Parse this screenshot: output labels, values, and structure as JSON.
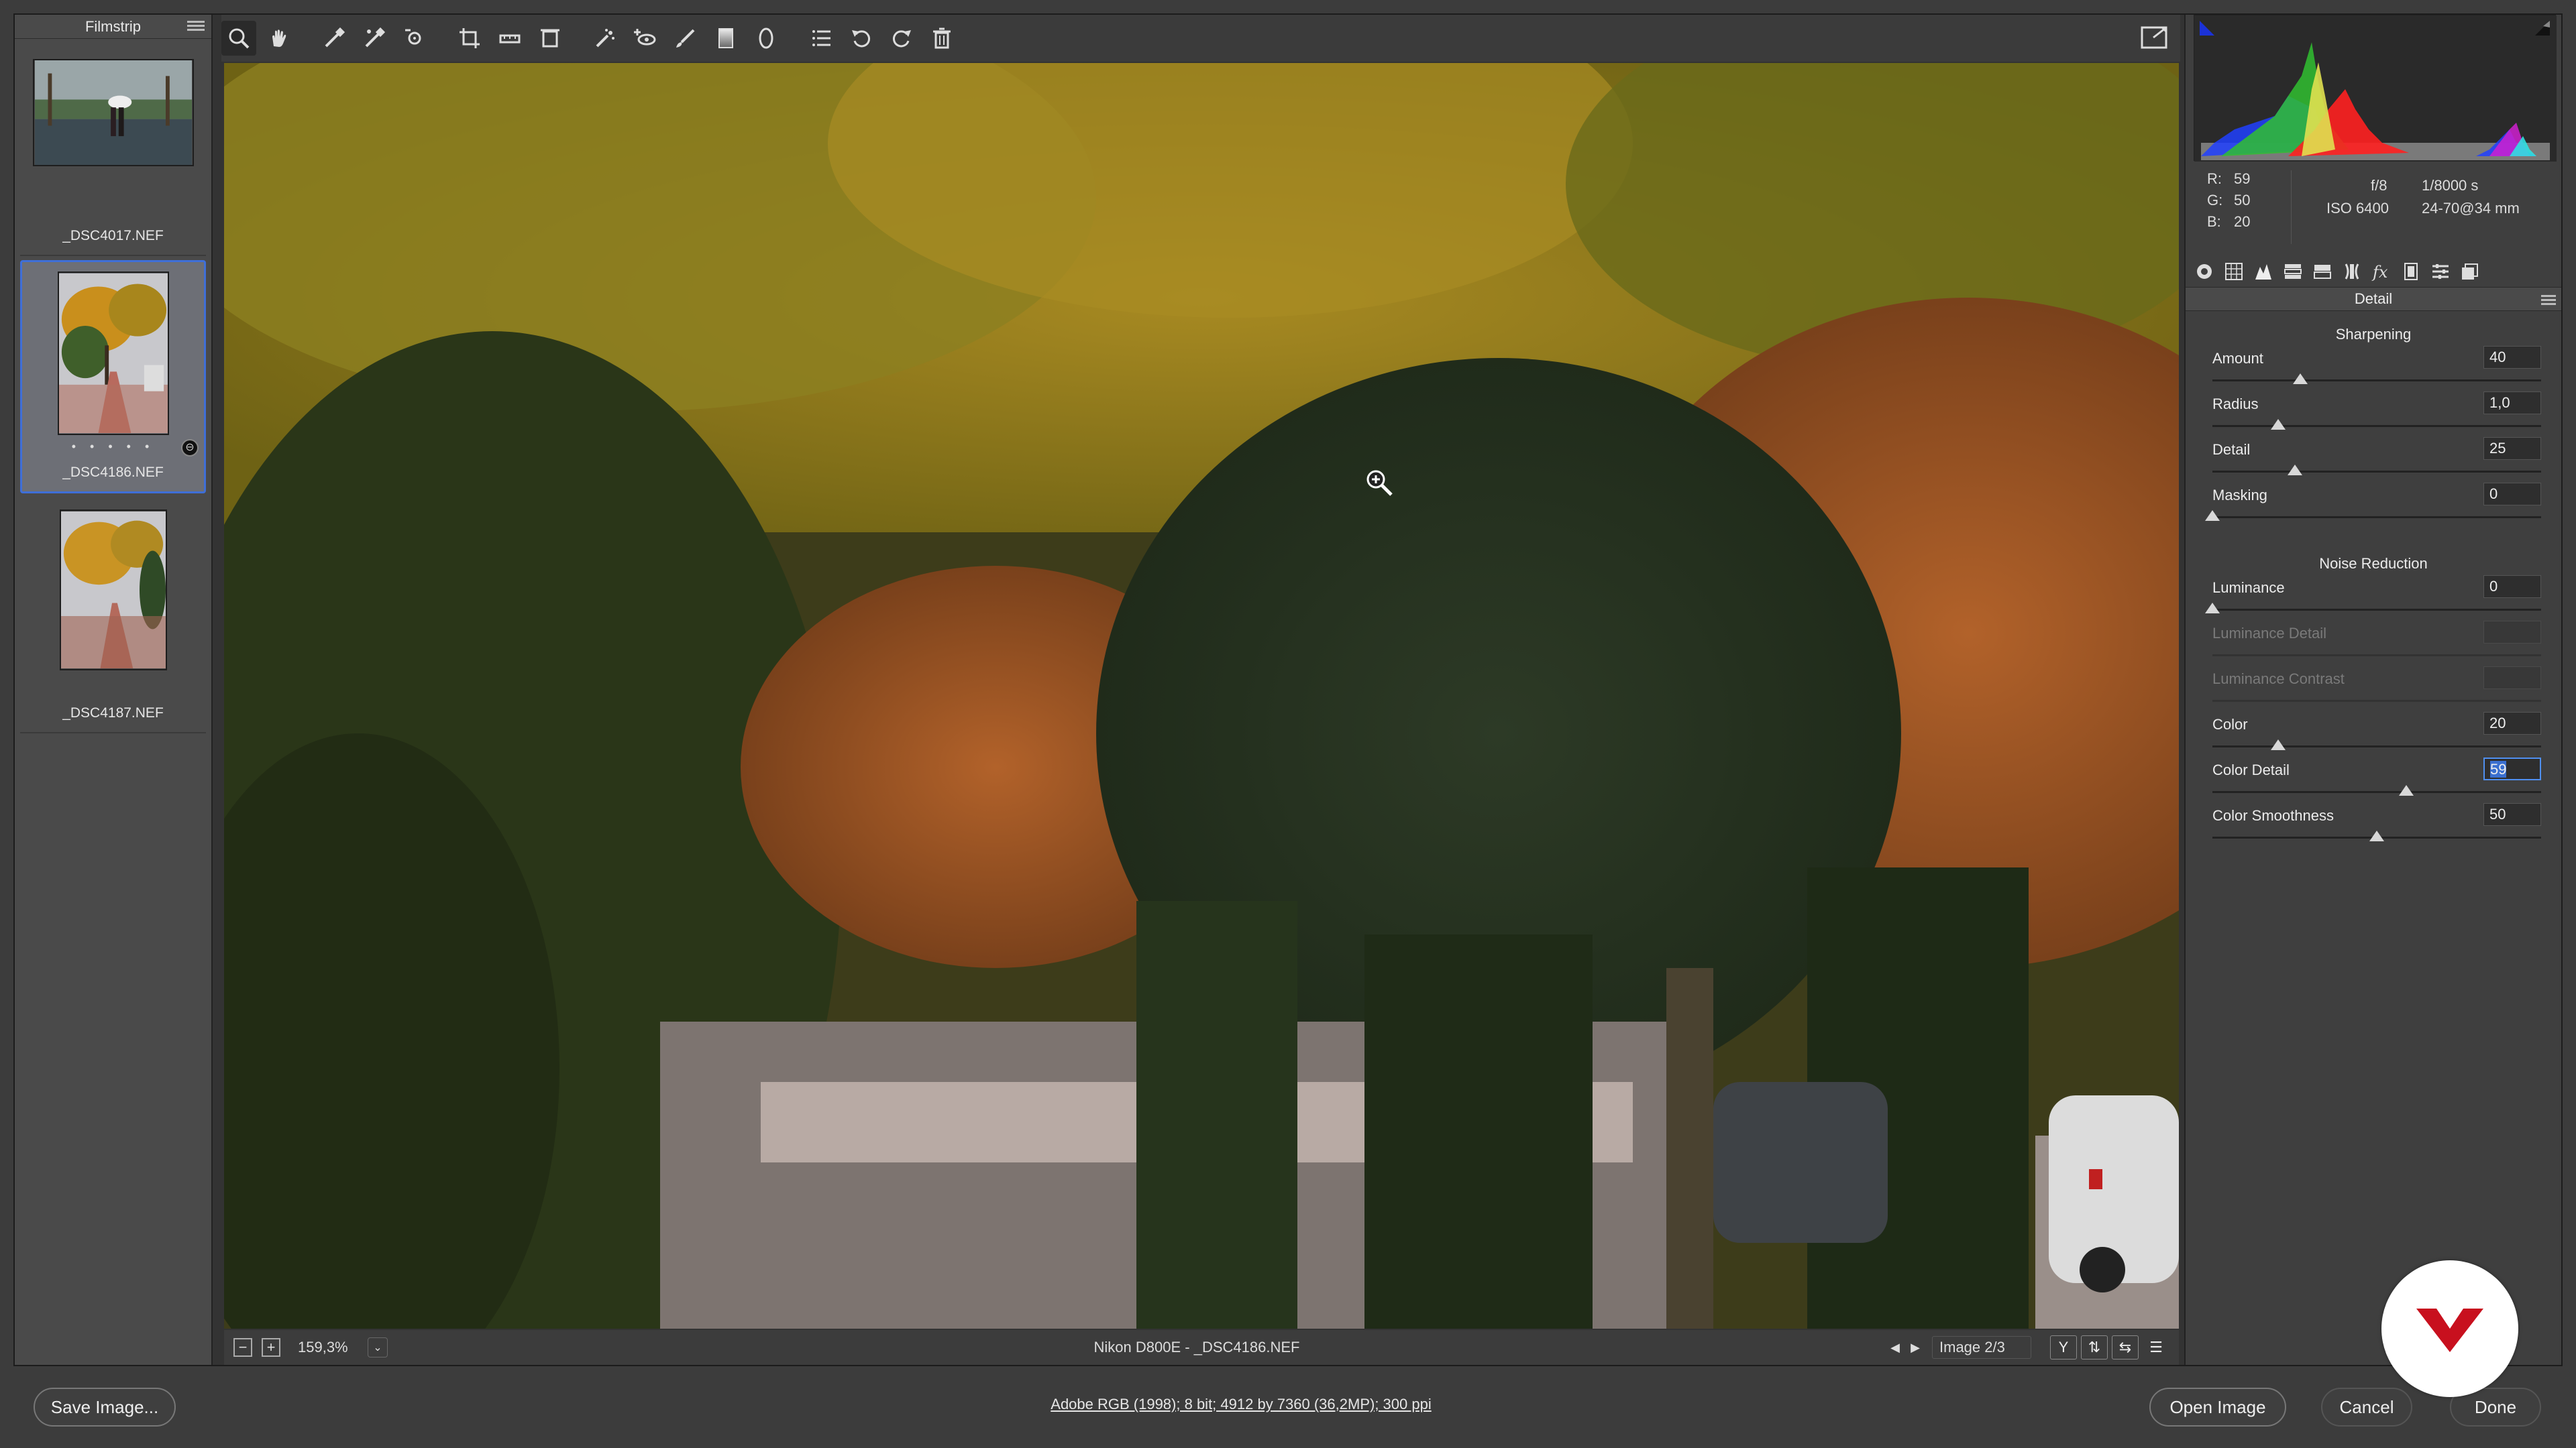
{
  "filmstrip": {
    "title": "Filmstrip",
    "items": [
      {
        "label": "_DSC4017.NEF",
        "selected": false,
        "rating": ""
      },
      {
        "label": "_DSC4186.NEF",
        "selected": true,
        "rating": "• • • • •"
      },
      {
        "label": "_DSC4187.NEF",
        "selected": false,
        "rating": ""
      }
    ]
  },
  "toolbar": {
    "tools": [
      "zoom-tool",
      "hand-tool",
      "white-balance-tool",
      "color-sampler-tool",
      "targeted-adjustment-tool",
      "crop-tool",
      "straighten-tool",
      "transform-tool",
      "spot-removal-tool",
      "red-eye-tool",
      "adjustment-brush-tool",
      "graduated-filter-tool",
      "radial-filter-tool",
      "presets-list",
      "rotate-left",
      "rotate-right",
      "delete"
    ],
    "active_tool": "zoom-tool"
  },
  "statusbar": {
    "zoom_minus": "−",
    "zoom_plus": "+",
    "zoom_level": "159,3%",
    "zoom_dropdown": "⌄",
    "camera_file": "Nikon D800E  -  _DSC4186.NEF",
    "prev": "◀",
    "next": "▶",
    "image_counter": "Image 2/3",
    "view_before_after": "Y",
    "view_swap": "⇅",
    "view_copy": "⇆",
    "view_settings": "☰"
  },
  "readout": {
    "r_label": "R:",
    "r_value": "59",
    "g_label": "G:",
    "g_value": "50",
    "b_label": "B:",
    "b_value": "20",
    "aperture": "f/8",
    "shutter": "1/8000 s",
    "iso": "ISO 6400",
    "lens": "24-70@34 mm"
  },
  "panel": {
    "title": "Detail",
    "sharpening_title": "Sharpening",
    "noise_title": "Noise Reduction",
    "sharpening": [
      {
        "label": "Amount",
        "value": "40",
        "pos": 0.267,
        "disabled": false
      },
      {
        "label": "Radius",
        "value": "1,0",
        "pos": 0.2,
        "disabled": false
      },
      {
        "label": "Detail",
        "value": "25",
        "pos": 0.25,
        "disabled": false
      },
      {
        "label": "Masking",
        "value": "0",
        "pos": 0.0,
        "disabled": false
      }
    ],
    "noise": [
      {
        "label": "Luminance",
        "value": "0",
        "pos": 0.0,
        "disabled": false
      },
      {
        "label": "Luminance Detail",
        "value": "",
        "pos": null,
        "disabled": true
      },
      {
        "label": "Luminance Contrast",
        "value": "",
        "pos": null,
        "disabled": true
      },
      {
        "label": "Color",
        "value": "20",
        "pos": 0.2,
        "disabled": false
      },
      {
        "label": "Color Detail",
        "value": "59",
        "pos": 0.59,
        "disabled": false,
        "focused": true
      },
      {
        "label": "Color Smoothness",
        "value": "50",
        "pos": 0.5,
        "disabled": false
      }
    ]
  },
  "bottom": {
    "save_label": "Save Image...",
    "workflow": "Adobe RGB (1998); 8 bit; 4912 by 7360 (36,2MP); 300 ppi",
    "open_label": "Open Image",
    "cancel_label": "Cancel",
    "done_label": "Done"
  },
  "colors": {
    "accent": "#3f6fd8",
    "panel_bg": "#3f3f3f",
    "histogram_bg": "#2a2a2a",
    "logo_red": "#c8101e"
  }
}
